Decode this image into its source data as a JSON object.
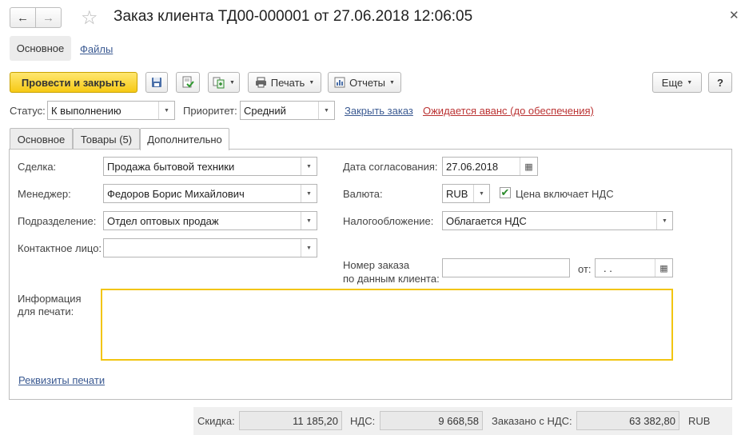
{
  "window": {
    "title": "Заказ клиента ТД00-000001 от 27.06.2018 12:06:05",
    "back_icon": "arrow-left-icon",
    "forward_icon": "arrow-right-icon",
    "favorite_icon": "star-icon",
    "close_icon": "close-icon"
  },
  "sections": {
    "main": "Основное",
    "files": "Файлы"
  },
  "toolbar": {
    "post_close": "Провести и закрыть",
    "print": "Печать",
    "reports": "Отчеты",
    "more": "Еще",
    "help": "?"
  },
  "status_row": {
    "status_label": "Статус:",
    "status_value": "К выполнению",
    "priority_label": "Приоритет:",
    "priority_value": "Средний",
    "close_order": "Закрыть заказ",
    "awaiting_advance": "Ожидается аванс (до обеспечения)"
  },
  "tabs": {
    "main": "Основное",
    "goods": "Товары (5)",
    "extra": "Дополнительно"
  },
  "form": {
    "deal_label": "Сделка:",
    "deal_value": "Продажа бытовой техники",
    "manager_label": "Менеджер:",
    "manager_value": "Федоров Борис Михайлович",
    "department_label": "Подразделение:",
    "department_value": "Отдел оптовых продаж",
    "contact_label": "Контактное лицо:",
    "contact_value": "",
    "approval_date_label": "Дата согласования:",
    "approval_date_value": "27.06.2018",
    "currency_label": "Валюта:",
    "currency_value": "RUB",
    "price_incl_vat_label": "Цена включает НДС",
    "price_incl_vat_checked": true,
    "taxation_label": "Налогообложение:",
    "taxation_value": "Облагается НДС",
    "client_order_label_1": "Номер заказа",
    "client_order_label_2": "по данным клиента:",
    "client_order_value": "",
    "from_label": "от:",
    "from_value": ".  .",
    "print_info_label_1": "Информация",
    "print_info_label_2": "для печати:",
    "print_info_value": "",
    "print_requisites": "Реквизиты печати"
  },
  "totals": {
    "discount_label": "Скидка:",
    "discount_value": "11 185,20",
    "vat_label": "НДС:",
    "vat_value": "9 668,58",
    "ordered_label": "Заказано с НДС:",
    "ordered_value": "63 382,80",
    "currency": "RUB"
  },
  "colors": {
    "accent": "#f6c915",
    "link": "#3b5a92",
    "warning_link": "#b33333"
  }
}
